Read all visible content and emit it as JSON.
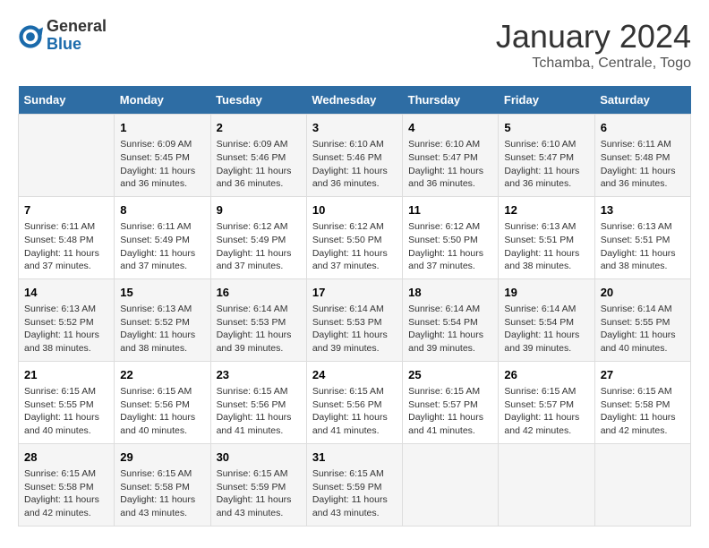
{
  "header": {
    "logo_general": "General",
    "logo_blue": "Blue",
    "title": "January 2024",
    "subtitle": "Tchamba, Centrale, Togo"
  },
  "columns": [
    "Sunday",
    "Monday",
    "Tuesday",
    "Wednesday",
    "Thursday",
    "Friday",
    "Saturday"
  ],
  "weeks": [
    [
      {
        "num": "",
        "info": ""
      },
      {
        "num": "1",
        "info": "Sunrise: 6:09 AM\nSunset: 5:45 PM\nDaylight: 11 hours\nand 36 minutes."
      },
      {
        "num": "2",
        "info": "Sunrise: 6:09 AM\nSunset: 5:46 PM\nDaylight: 11 hours\nand 36 minutes."
      },
      {
        "num": "3",
        "info": "Sunrise: 6:10 AM\nSunset: 5:46 PM\nDaylight: 11 hours\nand 36 minutes."
      },
      {
        "num": "4",
        "info": "Sunrise: 6:10 AM\nSunset: 5:47 PM\nDaylight: 11 hours\nand 36 minutes."
      },
      {
        "num": "5",
        "info": "Sunrise: 6:10 AM\nSunset: 5:47 PM\nDaylight: 11 hours\nand 36 minutes."
      },
      {
        "num": "6",
        "info": "Sunrise: 6:11 AM\nSunset: 5:48 PM\nDaylight: 11 hours\nand 36 minutes."
      }
    ],
    [
      {
        "num": "7",
        "info": "Sunrise: 6:11 AM\nSunset: 5:48 PM\nDaylight: 11 hours\nand 37 minutes."
      },
      {
        "num": "8",
        "info": "Sunrise: 6:11 AM\nSunset: 5:49 PM\nDaylight: 11 hours\nand 37 minutes."
      },
      {
        "num": "9",
        "info": "Sunrise: 6:12 AM\nSunset: 5:49 PM\nDaylight: 11 hours\nand 37 minutes."
      },
      {
        "num": "10",
        "info": "Sunrise: 6:12 AM\nSunset: 5:50 PM\nDaylight: 11 hours\nand 37 minutes."
      },
      {
        "num": "11",
        "info": "Sunrise: 6:12 AM\nSunset: 5:50 PM\nDaylight: 11 hours\nand 37 minutes."
      },
      {
        "num": "12",
        "info": "Sunrise: 6:13 AM\nSunset: 5:51 PM\nDaylight: 11 hours\nand 38 minutes."
      },
      {
        "num": "13",
        "info": "Sunrise: 6:13 AM\nSunset: 5:51 PM\nDaylight: 11 hours\nand 38 minutes."
      }
    ],
    [
      {
        "num": "14",
        "info": "Sunrise: 6:13 AM\nSunset: 5:52 PM\nDaylight: 11 hours\nand 38 minutes."
      },
      {
        "num": "15",
        "info": "Sunrise: 6:13 AM\nSunset: 5:52 PM\nDaylight: 11 hours\nand 38 minutes."
      },
      {
        "num": "16",
        "info": "Sunrise: 6:14 AM\nSunset: 5:53 PM\nDaylight: 11 hours\nand 39 minutes."
      },
      {
        "num": "17",
        "info": "Sunrise: 6:14 AM\nSunset: 5:53 PM\nDaylight: 11 hours\nand 39 minutes."
      },
      {
        "num": "18",
        "info": "Sunrise: 6:14 AM\nSunset: 5:54 PM\nDaylight: 11 hours\nand 39 minutes."
      },
      {
        "num": "19",
        "info": "Sunrise: 6:14 AM\nSunset: 5:54 PM\nDaylight: 11 hours\nand 39 minutes."
      },
      {
        "num": "20",
        "info": "Sunrise: 6:14 AM\nSunset: 5:55 PM\nDaylight: 11 hours\nand 40 minutes."
      }
    ],
    [
      {
        "num": "21",
        "info": "Sunrise: 6:15 AM\nSunset: 5:55 PM\nDaylight: 11 hours\nand 40 minutes."
      },
      {
        "num": "22",
        "info": "Sunrise: 6:15 AM\nSunset: 5:56 PM\nDaylight: 11 hours\nand 40 minutes."
      },
      {
        "num": "23",
        "info": "Sunrise: 6:15 AM\nSunset: 5:56 PM\nDaylight: 11 hours\nand 41 minutes."
      },
      {
        "num": "24",
        "info": "Sunrise: 6:15 AM\nSunset: 5:56 PM\nDaylight: 11 hours\nand 41 minutes."
      },
      {
        "num": "25",
        "info": "Sunrise: 6:15 AM\nSunset: 5:57 PM\nDaylight: 11 hours\nand 41 minutes."
      },
      {
        "num": "26",
        "info": "Sunrise: 6:15 AM\nSunset: 5:57 PM\nDaylight: 11 hours\nand 42 minutes."
      },
      {
        "num": "27",
        "info": "Sunrise: 6:15 AM\nSunset: 5:58 PM\nDaylight: 11 hours\nand 42 minutes."
      }
    ],
    [
      {
        "num": "28",
        "info": "Sunrise: 6:15 AM\nSunset: 5:58 PM\nDaylight: 11 hours\nand 42 minutes."
      },
      {
        "num": "29",
        "info": "Sunrise: 6:15 AM\nSunset: 5:58 PM\nDaylight: 11 hours\nand 43 minutes."
      },
      {
        "num": "30",
        "info": "Sunrise: 6:15 AM\nSunset: 5:59 PM\nDaylight: 11 hours\nand 43 minutes."
      },
      {
        "num": "31",
        "info": "Sunrise: 6:15 AM\nSunset: 5:59 PM\nDaylight: 11 hours\nand 43 minutes."
      },
      {
        "num": "",
        "info": ""
      },
      {
        "num": "",
        "info": ""
      },
      {
        "num": "",
        "info": ""
      }
    ]
  ]
}
